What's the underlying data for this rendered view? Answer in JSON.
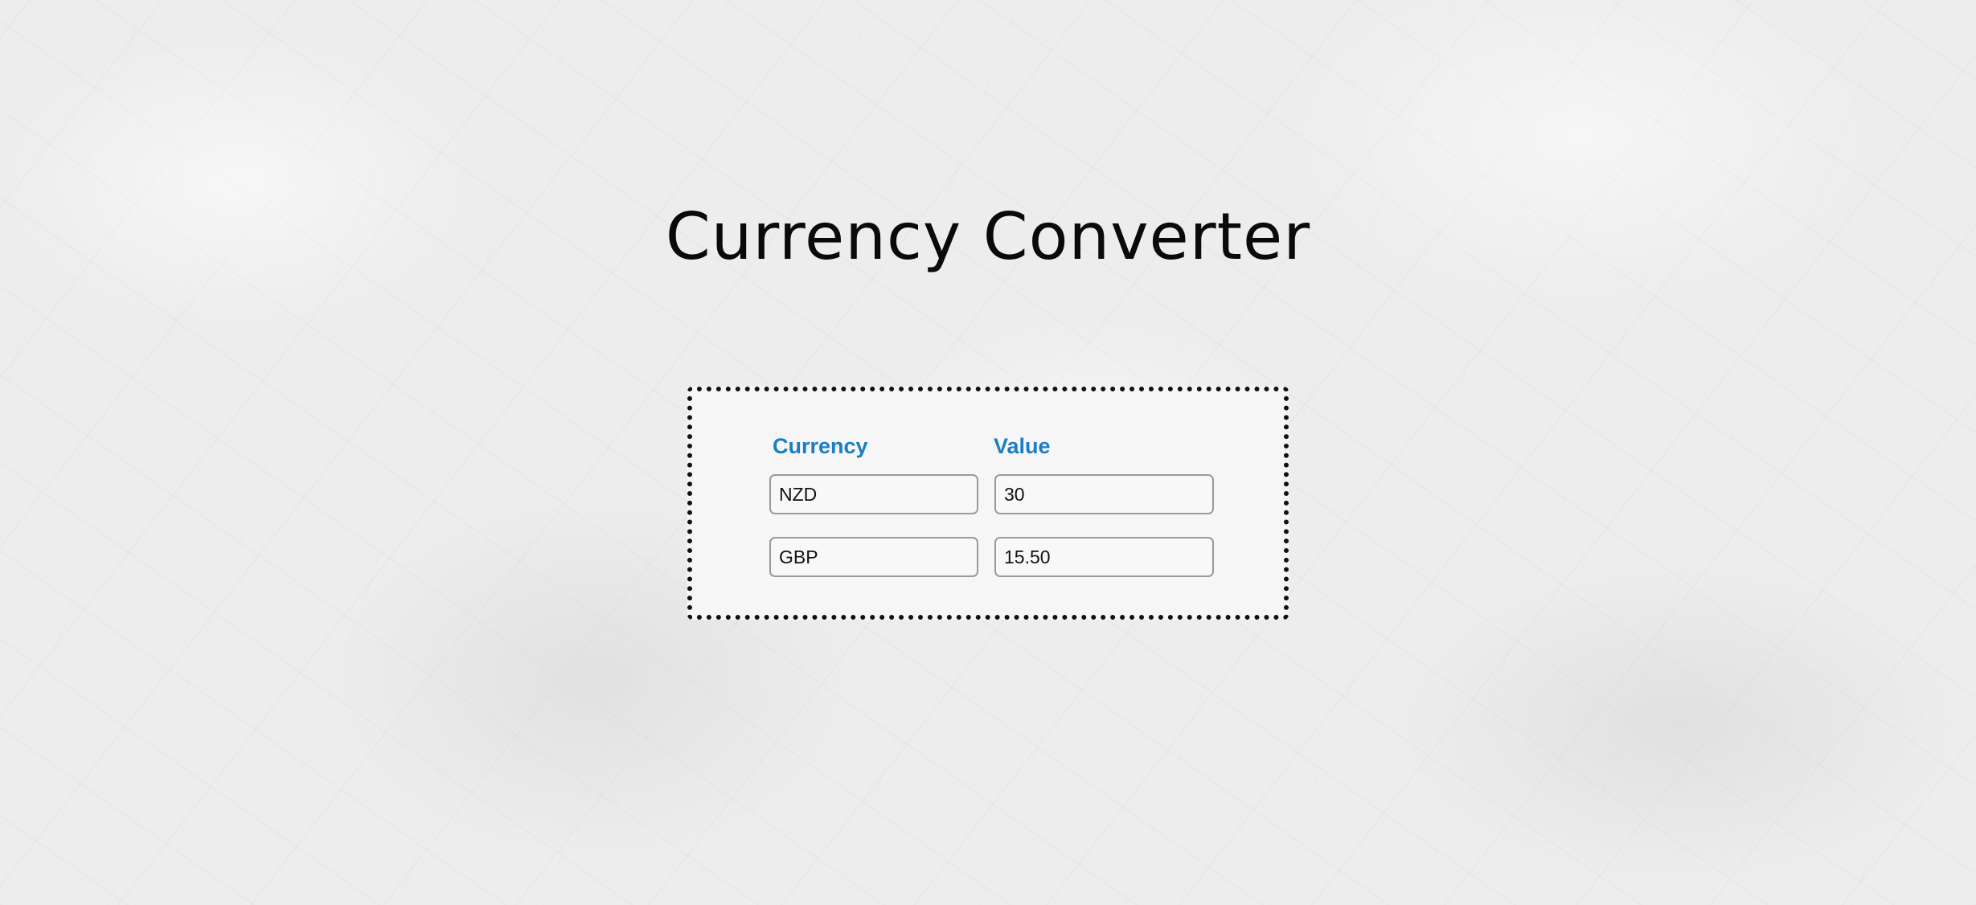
{
  "title": "Currency Converter",
  "converter": {
    "headers": {
      "currency": "Currency",
      "value": "Value"
    },
    "rows": [
      {
        "currency": "NZD",
        "value": "30"
      },
      {
        "currency": "GBP",
        "value": "15.50"
      }
    ]
  },
  "colors": {
    "header_accent": "#1b7ec2",
    "title_text": "#0a0a0a",
    "box_border": "#111111",
    "background": "#ededed"
  }
}
